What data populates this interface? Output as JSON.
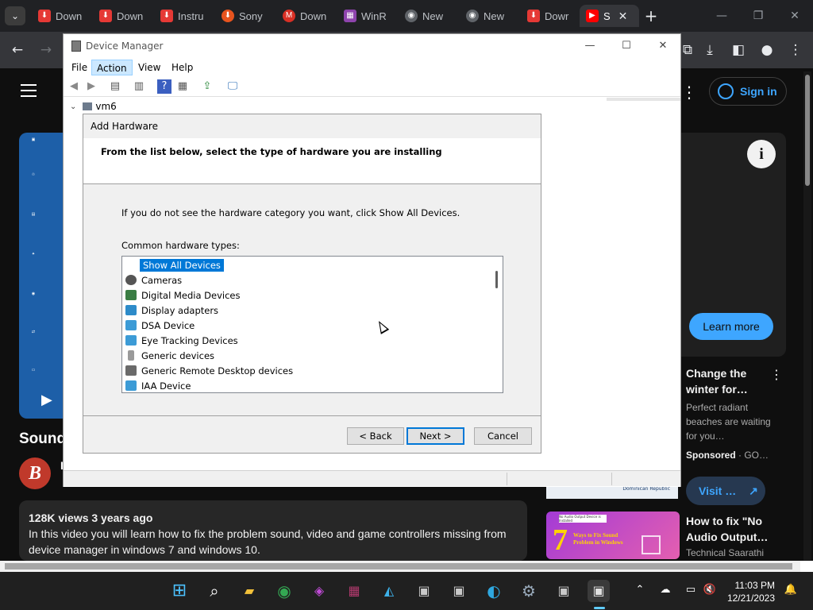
{
  "browser": {
    "tabs": [
      {
        "label": "Down",
        "icon": "download-icon",
        "color": "#e53935"
      },
      {
        "label": "Down",
        "icon": "download-icon",
        "color": "#e53935"
      },
      {
        "label": "Instru",
        "icon": "download-icon",
        "color": "#e53935"
      },
      {
        "label": "Sony",
        "icon": "sony-icon",
        "color": "#e8541e"
      },
      {
        "label": "Down",
        "icon": "m-icon",
        "color": "#d93025"
      },
      {
        "label": "WinR",
        "icon": "winrar-icon",
        "color": "#8e44ad"
      },
      {
        "label": "New",
        "icon": "chrome-icon",
        "color": "#9aa0a6"
      },
      {
        "label": "New",
        "icon": "chrome-icon",
        "color": "#9aa0a6"
      },
      {
        "label": "Dowr",
        "icon": "download-icon",
        "color": "#e53935"
      },
      {
        "label": "S",
        "icon": "youtube-icon",
        "color": "#ff0000"
      }
    ],
    "active_tab_close": "✕",
    "new_tab": "+"
  },
  "youtube": {
    "sign_in": "Sign in",
    "video_title": "Sound",
    "channel_letter": "B",
    "channel_name_partial": "L",
    "views_line": "128K views  3 years ago",
    "description": "In this video you will learn how to fix the problem sound, video and game controllers missing from device manager in windows 7 and windows 10.",
    "ad": {
      "learn_more": "Learn more",
      "title": "Change the winter for…",
      "desc": "Perfect radiant beaches are waiting for you…",
      "sponsored": "Sponsored",
      "advertiser": "GO…",
      "visit": "Visit …",
      "thumb_caption": "Dominican Republic"
    },
    "next_video": {
      "title": "How to fix \"No Audio Output…",
      "channel": "Technical Saarathi",
      "thumb_big": "7",
      "thumb_tag": "No Audio Output Device is Installed",
      "thumb_text": "Ways to Fix Sound Problem in Windows"
    }
  },
  "device_manager": {
    "title": "Device Manager",
    "menu": [
      "File",
      "Action",
      "View",
      "Help"
    ],
    "active_menu": "Action",
    "tree_root": "vm6"
  },
  "add_hardware": {
    "title": "Add Hardware",
    "heading": "From the list below, select the type of hardware you are installing",
    "info": "If you do not see the hardware category you want, click Show All Devices.",
    "list_label": "Common hardware types:",
    "items": [
      {
        "label": "Show All Devices",
        "icon": "none",
        "selected": true
      },
      {
        "label": "Cameras",
        "icon": "camera-icon"
      },
      {
        "label": "Digital Media Devices",
        "icon": "media-device-icon"
      },
      {
        "label": "Display adapters",
        "icon": "display-adapter-icon"
      },
      {
        "label": "DSA Device",
        "icon": "monitor-icon"
      },
      {
        "label": "Eye Tracking Devices",
        "icon": "monitor-icon"
      },
      {
        "label": "Generic devices",
        "icon": "generic-device-icon"
      },
      {
        "label": "Generic Remote Desktop devices",
        "icon": "remote-desktop-icon"
      },
      {
        "label": "IAA Device",
        "icon": "monitor-icon"
      }
    ],
    "buttons": {
      "back": "< Back",
      "next": "Next >",
      "cancel": "Cancel"
    }
  },
  "taskbar": {
    "time": "11:03 PM",
    "date": "12/21/2023",
    "apps": [
      "windows-start-icon",
      "search-icon",
      "file-explorer-icon",
      "chrome-icon",
      "game-app-icon",
      "winrar-icon",
      "capcut-icon",
      "device-app-icon",
      "device-app-icon",
      "edge-icon",
      "settings-icon",
      "device-app-icon",
      "device-manager-icon"
    ]
  }
}
